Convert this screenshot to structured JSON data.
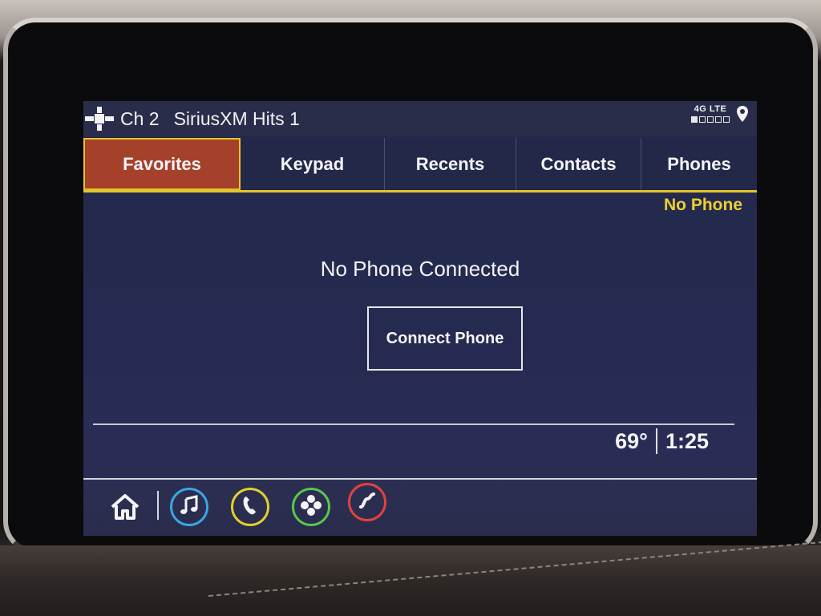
{
  "status": {
    "channel": "Ch 2",
    "station": "SiriusXM Hits 1",
    "network": "4G LTE",
    "signal_level": 1,
    "signal_max": 5,
    "icons": [
      "satellite-icon",
      "location-pin-icon"
    ]
  },
  "tabs": [
    {
      "label": "Favorites",
      "active": true
    },
    {
      "label": "Keypad",
      "active": false
    },
    {
      "label": "Recents",
      "active": false
    },
    {
      "label": "Contacts",
      "active": false
    },
    {
      "label": "Phones",
      "active": false
    }
  ],
  "phone_status": "No Phone",
  "main": {
    "message": "No Phone Connected",
    "connect_button": "Connect Phone"
  },
  "footer": {
    "temperature": "69°",
    "time": "1:25"
  },
  "nav": {
    "icons": [
      "home-icon",
      "music-icon",
      "phone-icon",
      "apps-icon",
      "navigation-icon"
    ]
  },
  "colors": {
    "accent_yellow": "#e3c52a",
    "active_tab": "#a5402b",
    "screen_bg": "#23284b",
    "audio": "#3aa6e4",
    "phone": "#e4cf2a",
    "apps": "#57c84a",
    "navigation": "#e2433d"
  }
}
